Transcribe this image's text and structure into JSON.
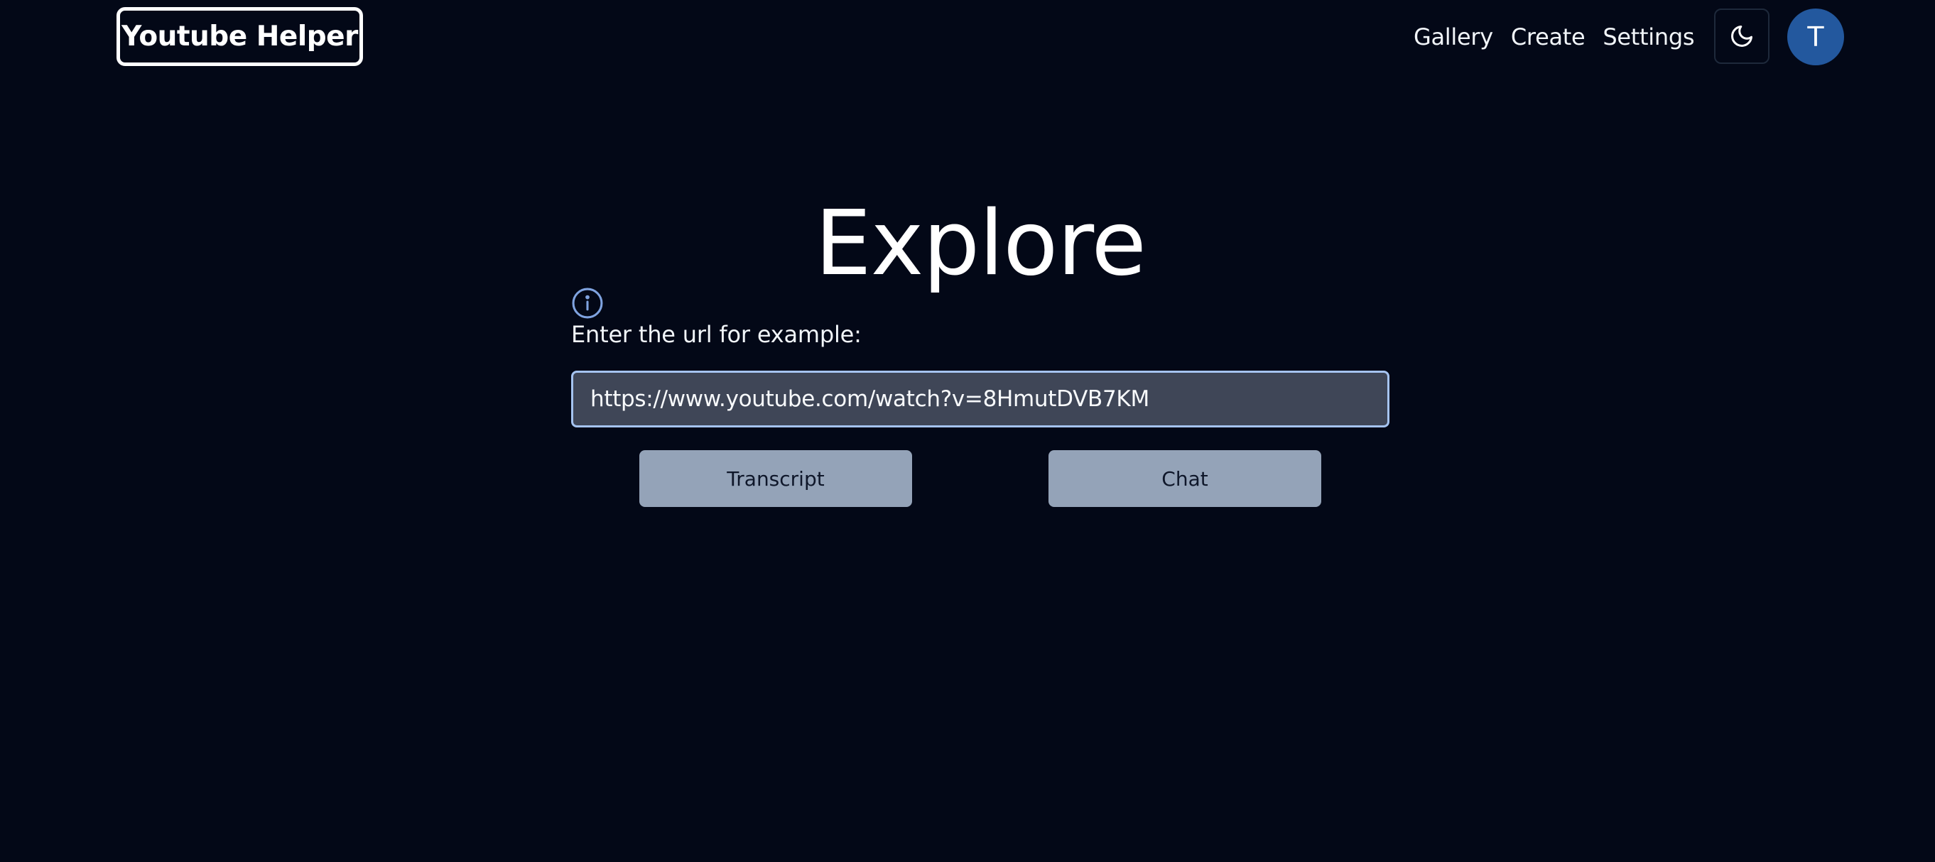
{
  "header": {
    "logo": "Youtube Helper",
    "nav": [
      {
        "label": "Gallery"
      },
      {
        "label": "Create"
      },
      {
        "label": "Settings"
      }
    ],
    "theme_toggle_icon": "moon-icon",
    "avatar_initial": "T"
  },
  "main": {
    "title": "Explore",
    "info_icon": "info-icon",
    "label": "Enter the url for example:",
    "url_value": "https://www.youtube.com/watch?v=8HmutDVB7KM",
    "buttons": {
      "transcript": "Transcript",
      "chat": "Chat"
    }
  },
  "colors": {
    "background": "#030817",
    "avatar": "#23589e",
    "button": "#94a3b8",
    "input_bg": "#3f4657",
    "input_border": "#a5c3f0",
    "info_icon": "#7fa3e0"
  }
}
